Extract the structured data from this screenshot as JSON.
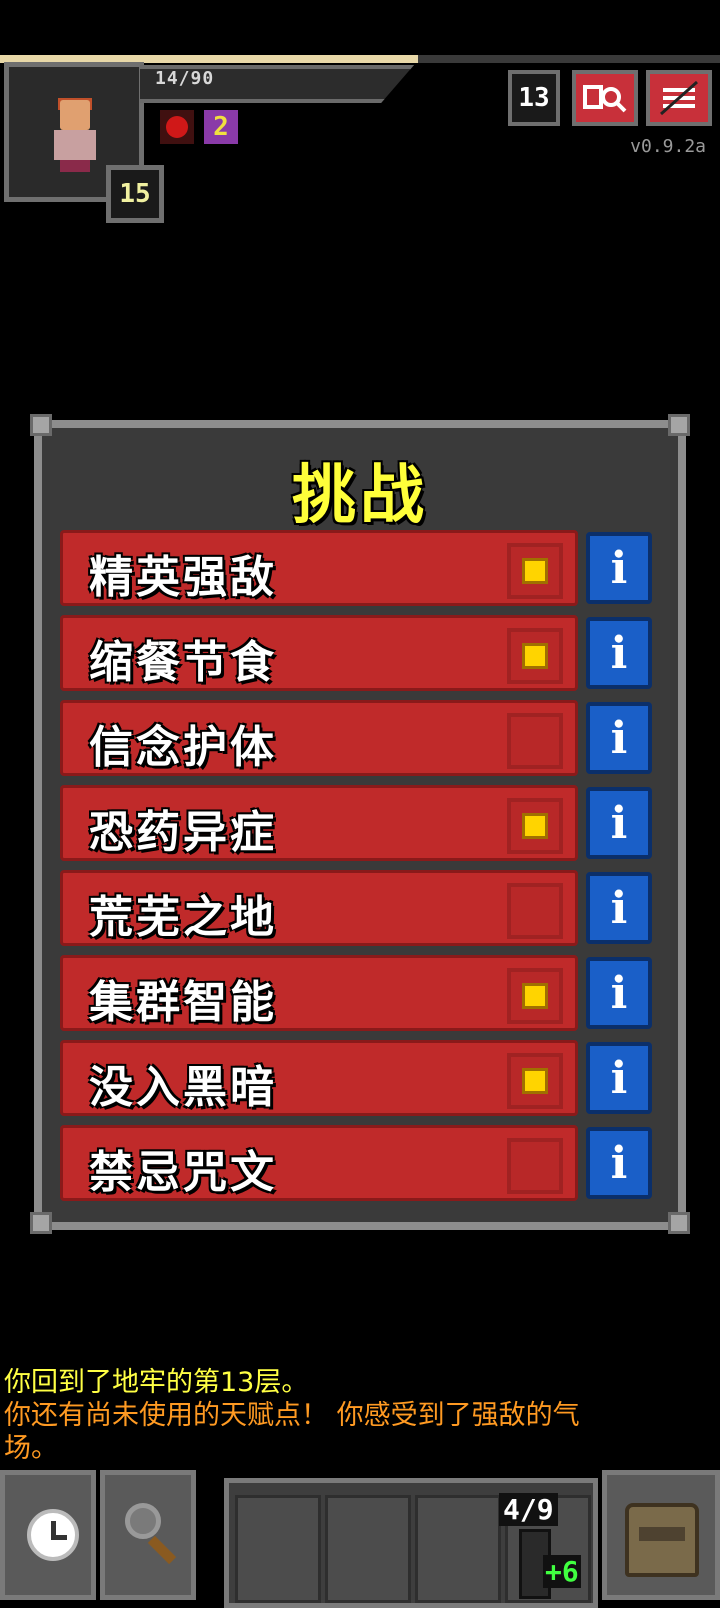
{
  "hud": {
    "hp_text": "14/90",
    "hp_fraction": 0.58,
    "hero_level": "15",
    "buff_icons": [
      "bleeding-icon",
      "level-2-buff-icon"
    ],
    "buff_value": "2",
    "depth": "13",
    "version": "v0.9.2a",
    "journal_icon": "journal-icon",
    "menu_icon": "menu-icon"
  },
  "challenges": {
    "title": "挑战",
    "items": [
      {
        "label": "精英强敌",
        "checked": true
      },
      {
        "label": "缩餐节食",
        "checked": true
      },
      {
        "label": "信念护体",
        "checked": false
      },
      {
        "label": "恐药异症",
        "checked": true
      },
      {
        "label": "荒芜之地",
        "checked": false
      },
      {
        "label": "集群智能",
        "checked": true
      },
      {
        "label": "没入黑暗",
        "checked": true
      },
      {
        "label": "禁忌咒文",
        "checked": false
      }
    ],
    "info_label": "i"
  },
  "log": {
    "line1": "你回到了地牢的第13层。",
    "line2": "你还有尚未使用的天赋点！ 你感受到了强敌的气场。"
  },
  "toolbar": {
    "wait_icon": "clock-icon",
    "search_icon": "magnifier-icon",
    "quiver_count": "4/9",
    "quiver_bonus": "+6",
    "backpack_icon": "backpack-icon"
  },
  "colors": {
    "row_red": "#c02a2a",
    "info_blue": "#1a5fc8",
    "title_yellow": "#ffff3a",
    "check_gold": "#ffd400"
  }
}
